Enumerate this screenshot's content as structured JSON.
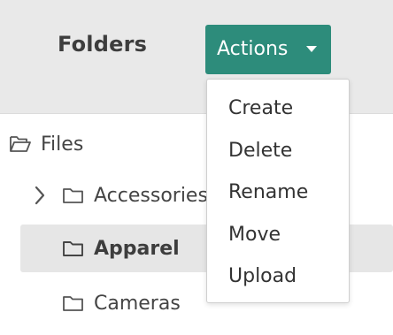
{
  "header": {
    "title": "Folders",
    "actions_label": "Actions"
  },
  "colors": {
    "accent": "#2d8c7b",
    "selected_row": "#e6e6e6",
    "header_bg": "#e9e9e9"
  },
  "tree": {
    "root": {
      "label": "Files",
      "icon": "folder-open-icon"
    },
    "items": [
      {
        "label": "Accessories",
        "icon": "folder-icon",
        "expandable": true
      },
      {
        "label": "Apparel",
        "icon": "folder-icon",
        "selected": true
      },
      {
        "label": "Cameras",
        "icon": "folder-icon"
      }
    ]
  },
  "dropdown": {
    "items": [
      {
        "label": "Create"
      },
      {
        "label": "Delete"
      },
      {
        "label": "Rename"
      },
      {
        "label": "Move"
      },
      {
        "label": "Upload"
      }
    ]
  }
}
